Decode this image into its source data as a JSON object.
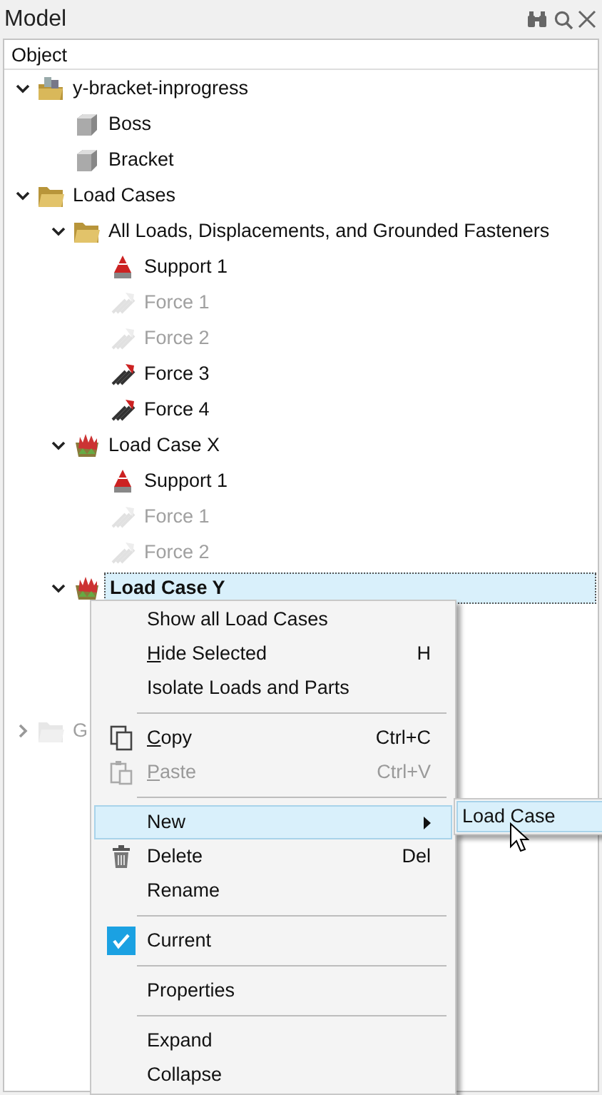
{
  "panel": {
    "title": "Model"
  },
  "column": {
    "label": "Object"
  },
  "tree": [
    {
      "label": "y-bracket-inprogress",
      "kind": "assembly",
      "expanded": true,
      "active": true,
      "selected": false,
      "children": [
        {
          "label": "Boss",
          "kind": "part",
          "active": true,
          "selected": false
        },
        {
          "label": "Bracket",
          "kind": "part",
          "active": true,
          "selected": false
        }
      ]
    },
    {
      "label": "Load Cases",
      "kind": "folder",
      "expanded": true,
      "active": true,
      "selected": false,
      "children": [
        {
          "label": "All Loads, Displacements, and Grounded Fasteners",
          "kind": "folder",
          "expanded": true,
          "active": true,
          "selected": false,
          "children": [
            {
              "label": "Support 1",
              "kind": "support",
              "active": true,
              "selected": false
            },
            {
              "label": "Force 1",
              "kind": "force",
              "active": false,
              "selected": false
            },
            {
              "label": "Force 2",
              "kind": "force",
              "active": false,
              "selected": false
            },
            {
              "label": "Force 3",
              "kind": "force",
              "active": true,
              "selected": false
            },
            {
              "label": "Force 4",
              "kind": "force",
              "active": true,
              "selected": false
            }
          ]
        },
        {
          "label": "Load Case X",
          "kind": "loadcase",
          "expanded": true,
          "active": true,
          "selected": false,
          "children": [
            {
              "label": "Support 1",
              "kind": "support",
              "active": true,
              "selected": false
            },
            {
              "label": "Force 1",
              "kind": "force",
              "active": false,
              "selected": false
            },
            {
              "label": "Force 2",
              "kind": "force",
              "active": false,
              "selected": false
            }
          ]
        },
        {
          "label": "Load Case Y",
          "kind": "loadcase",
          "expanded": true,
          "active": true,
          "selected": true
        }
      ]
    },
    {
      "label": "G",
      "kind": "folder",
      "expanded": false,
      "active": false,
      "selected": false
    }
  ],
  "context_menu": [
    {
      "kind": "plain",
      "label": "Show all Load Cases",
      "underline_first": false,
      "disabled": false,
      "selected": false
    },
    {
      "kind": "plain",
      "label": "Hide Selected",
      "shortcut": "H",
      "underline_first": true,
      "disabled": false,
      "selected": false
    },
    {
      "kind": "plain",
      "label": "Isolate Loads and Parts",
      "underline_first": false,
      "disabled": false,
      "selected": false
    },
    {
      "kind": "separator"
    },
    {
      "kind": "copy",
      "label": "Copy",
      "shortcut": "Ctrl+C",
      "underline_first": true,
      "disabled": false,
      "selected": false
    },
    {
      "kind": "paste",
      "label": "Paste",
      "shortcut": "Ctrl+V",
      "underline_first": true,
      "disabled": true,
      "selected": false
    },
    {
      "kind": "separator"
    },
    {
      "kind": "submenu",
      "label": "New",
      "underline_first": false,
      "disabled": false,
      "selected": true
    },
    {
      "kind": "delete",
      "label": "Delete",
      "shortcut": "Del",
      "underline_first": false,
      "disabled": false,
      "selected": false
    },
    {
      "kind": "plain",
      "label": "Rename",
      "underline_first": false,
      "disabled": false,
      "selected": false
    },
    {
      "kind": "separator"
    },
    {
      "kind": "check",
      "label": "Current",
      "checked": true,
      "underline_first": false,
      "disabled": false,
      "selected": false
    },
    {
      "kind": "separator"
    },
    {
      "kind": "plain",
      "label": "Properties",
      "underline_first": false,
      "disabled": false,
      "selected": false
    },
    {
      "kind": "separator"
    },
    {
      "kind": "plain",
      "label": "Expand",
      "underline_first": false,
      "disabled": false,
      "selected": false
    },
    {
      "kind": "plain",
      "label": "Collapse",
      "underline_first": false,
      "disabled": false,
      "selected": false
    }
  ],
  "submenu": [
    {
      "label": "Load Case",
      "selected": true
    }
  ]
}
